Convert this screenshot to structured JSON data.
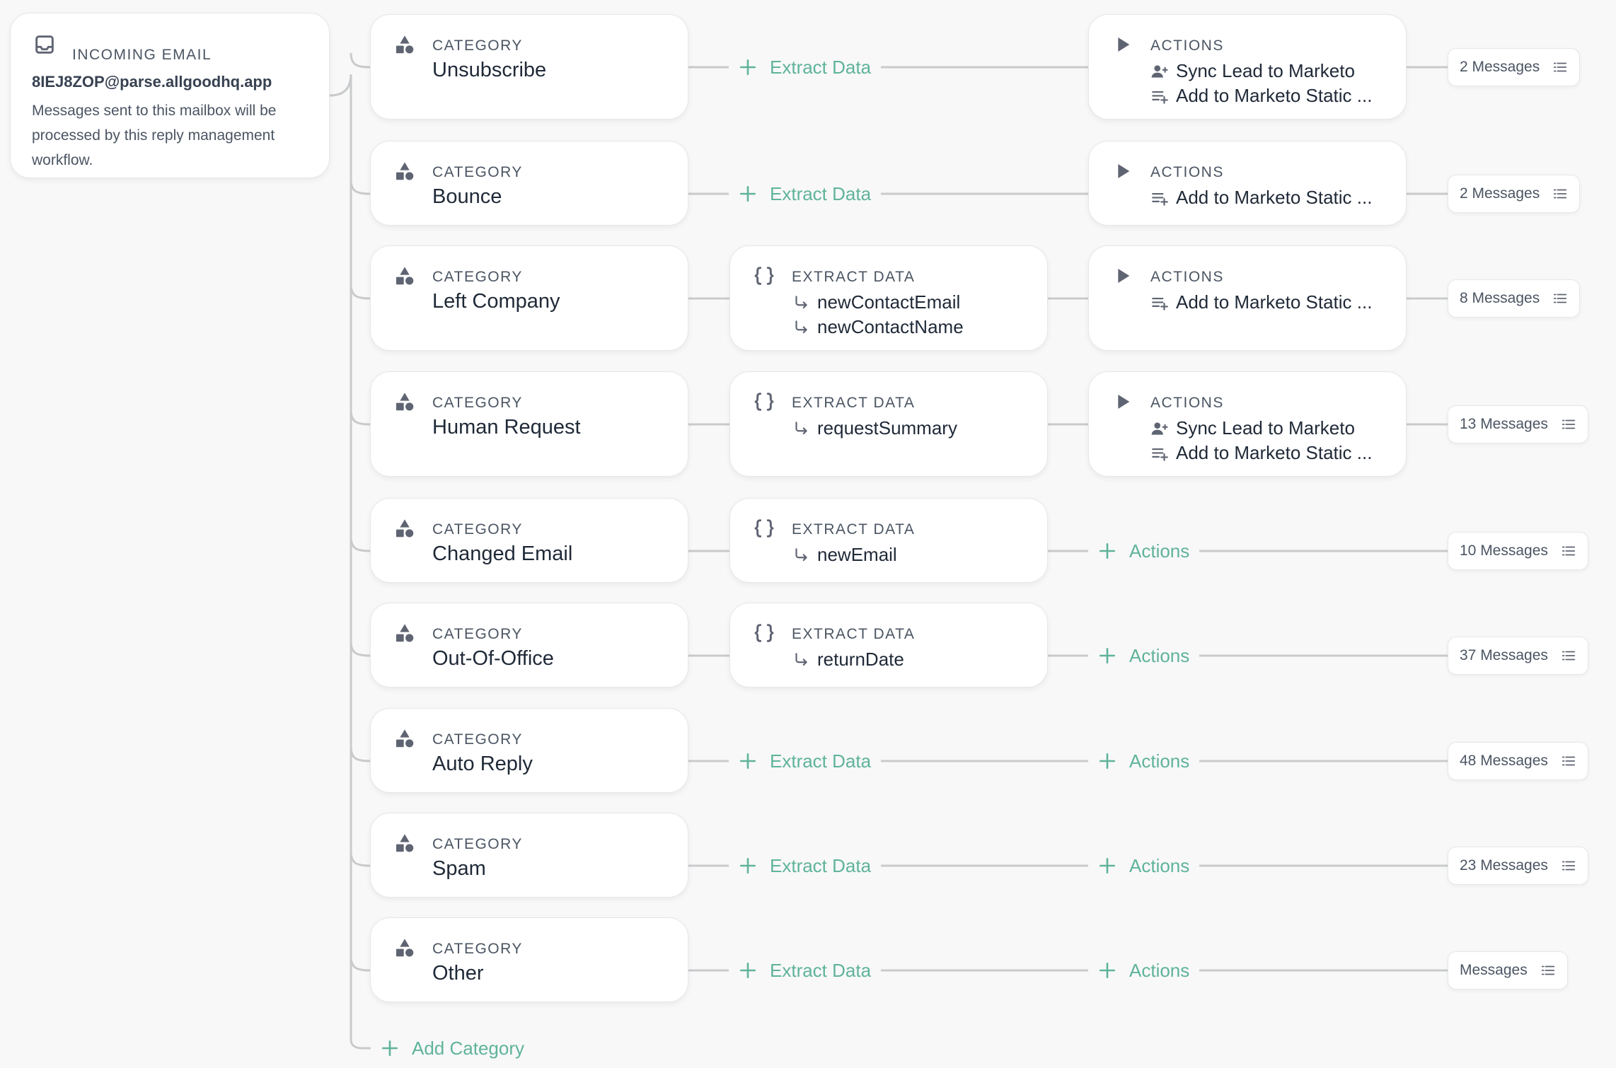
{
  "colors": {
    "accent": "#5fb39b",
    "connector": "#c9cacc",
    "card_border": "#e5e7eb",
    "icon": "#5f6472"
  },
  "incoming_email": {
    "label": "INCOMING EMAIL",
    "icon": "inbox-icon",
    "address": "8IEJ8ZOP@parse.allgoodhq.app",
    "description": "Messages sent to this mailbox will be processed by this reply management workflow."
  },
  "labels": {
    "category": "CATEGORY",
    "extract_data": "EXTRACT DATA",
    "actions": "ACTIONS",
    "add_extract": "Extract Data",
    "add_actions": "Actions",
    "add_category": "Add Category"
  },
  "rows": [
    {
      "category": "Unsubscribe",
      "extract": null,
      "actions": [
        {
          "icon": "user-plus-icon",
          "text": "Sync Lead to Marketo"
        },
        {
          "icon": "playlist-add-icon",
          "text": "Add to Marketo Static ..."
        }
      ],
      "messages": "2 Messages"
    },
    {
      "category": "Bounce",
      "extract": null,
      "actions": [
        {
          "icon": "playlist-add-icon",
          "text": "Add to Marketo Static ..."
        }
      ],
      "messages": "2 Messages"
    },
    {
      "category": "Left Company",
      "extract": [
        "newContactEmail",
        "newContactName"
      ],
      "actions": [
        {
          "icon": "playlist-add-icon",
          "text": "Add to Marketo Static ..."
        }
      ],
      "messages": "8 Messages"
    },
    {
      "category": "Human Request",
      "extract": [
        "requestSummary"
      ],
      "actions": [
        {
          "icon": "user-plus-icon",
          "text": "Sync Lead to Marketo"
        },
        {
          "icon": "playlist-add-icon",
          "text": "Add to Marketo Static ..."
        }
      ],
      "messages": "13 Messages"
    },
    {
      "category": "Changed Email",
      "extract": [
        "newEmail"
      ],
      "actions": null,
      "messages": "10 Messages"
    },
    {
      "category": "Out-Of-Office",
      "extract": [
        "returnDate"
      ],
      "actions": null,
      "messages": "37 Messages"
    },
    {
      "category": "Auto Reply",
      "extract": null,
      "actions": null,
      "messages": "48 Messages"
    },
    {
      "category": "Spam",
      "extract": null,
      "actions": null,
      "messages": "23 Messages"
    },
    {
      "category": "Other",
      "extract": null,
      "actions": null,
      "messages": "Messages"
    }
  ]
}
